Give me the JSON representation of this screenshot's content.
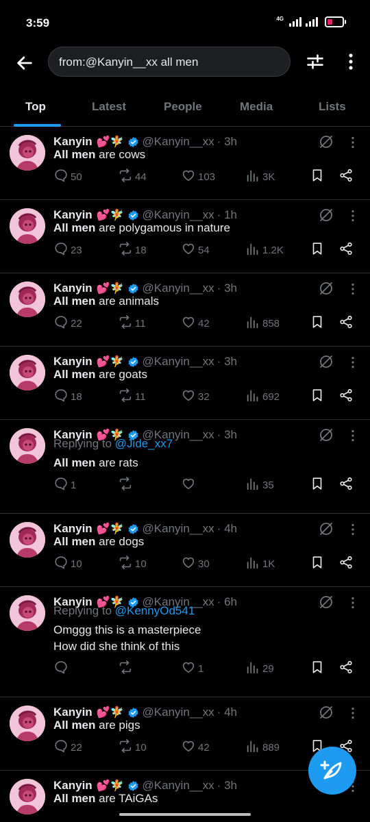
{
  "status_bar": {
    "time": "3:59",
    "network": "4G"
  },
  "search": {
    "query": "from:@Kanyin__xx all men"
  },
  "tabs": [
    "Top",
    "Latest",
    "People",
    "Media",
    "Lists"
  ],
  "colors": {
    "accent": "#1d9bf0",
    "muted": "#71767b",
    "text": "#e7e9ea",
    "background": "#000000"
  },
  "tweets": [
    {
      "name": "Kanyin",
      "emoji": "💕🧚",
      "handle": "@Kanyin__xx",
      "time": "· 3h",
      "text_bold": "All men",
      "text": "are cows",
      "replies": "50",
      "reposts": "44",
      "likes": "103",
      "views": "3K"
    },
    {
      "name": "Kanyin",
      "emoji": "💕🧚",
      "handle": "@Kanyin__xx",
      "time": "· 1h",
      "text_bold": "All men",
      "text": "are polygamous in nature",
      "replies": "23",
      "reposts": "18",
      "likes": "54",
      "views": "1.2K"
    },
    {
      "name": "Kanyin",
      "emoji": "💕🧚",
      "handle": "@Kanyin__xx",
      "time": "· 3h",
      "text_bold": "All men",
      "text": "are animals",
      "replies": "22",
      "reposts": "11",
      "likes": "42",
      "views": "858"
    },
    {
      "name": "Kanyin",
      "emoji": "💕🧚",
      "handle": "@Kanyin__xx",
      "time": "· 3h",
      "text_bold": "All men",
      "text": "are goats",
      "replies": "18",
      "reposts": "11",
      "likes": "32",
      "views": "692"
    },
    {
      "name": "Kanyin",
      "emoji": "💕🧚",
      "handle": "@Kanyin__xx",
      "time": "· 3h",
      "replying_prefix": "Replying to",
      "replying_to": "@Jide_xx7",
      "text_bold": "All men",
      "text": "are rats",
      "replies": "1",
      "reposts": "",
      "likes": "",
      "views": "35"
    },
    {
      "name": "Kanyin",
      "emoji": "💕🧚",
      "handle": "@Kanyin__xx",
      "time": "· 4h",
      "text_bold": "All men",
      "text": "are dogs",
      "replies": "10",
      "reposts": "10",
      "likes": "30",
      "views": "1K"
    },
    {
      "name": "Kanyin",
      "emoji": "💕🧚",
      "handle": "@Kanyin__xx",
      "time": "· 6h",
      "replying_prefix": "Replying to",
      "replying_to": "@KennyOd541",
      "text_line1": "Omggg this is a masterpiece",
      "text_line2": "How did she think of this",
      "replies": "",
      "reposts": "",
      "likes": "1",
      "views": "29"
    },
    {
      "name": "Kanyin",
      "emoji": "💕🧚",
      "handle": "@Kanyin__xx",
      "time": "· 4h",
      "text_bold": "All men",
      "text": "are pigs",
      "replies": "22",
      "reposts": "10",
      "likes": "42",
      "views": "889"
    },
    {
      "name": "Kanyin",
      "emoji": "💕🧚",
      "handle": "@Kanyin__xx",
      "time": "· 3h",
      "text_bold": "All men",
      "text": "are TAiGAs"
    }
  ]
}
